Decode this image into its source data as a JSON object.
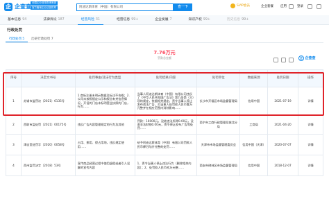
{
  "header": {
    "logo_text": "企查查",
    "logo_badges": [
      "全国企业信用查询系统",
      "官方备案企业征信机构"
    ],
    "search_value": "阿迪达斯体育（中国）有限公司",
    "search_button": "查一下",
    "svip_label": "SVIP会员",
    "nav": [
      "企业套餐",
      "应用",
      "登录"
    ]
  },
  "dim_tabs": [
    {
      "label": "基本信息",
      "count": "94",
      "state": "normal"
    },
    {
      "label": "法律诉讼",
      "count": "187",
      "state": "normal"
    },
    {
      "label": "经营风险",
      "count": "31",
      "state": "active"
    },
    {
      "label": "经营信息",
      "count": "99+",
      "state": "normal"
    },
    {
      "label": "企业发展",
      "count": "7",
      "state": "normal"
    },
    {
      "label": "知识产权",
      "count": "99+",
      "state": "normal"
    },
    {
      "label": "历史信息",
      "count": "99+",
      "state": "muted"
    }
  ],
  "section_title": "行政处罚",
  "sub_tabs": [
    {
      "label": "行政处罚 5",
      "active": true
    },
    {
      "label": "历史行政处罚 7",
      "active": false
    }
  ],
  "stats": {
    "value": "7.76万元",
    "label": "罚款总金额"
  },
  "qcc_stamp": "企查查",
  "table": {
    "headers": [
      "序号",
      "决定文书号",
      "处罚事由/违法行为类型",
      "处罚结果/内容",
      "处罚单位",
      "数据来源",
      "处罚日期",
      "操作"
    ],
    "rows": [
      {
        "index": "1",
        "doc": "苏锡市监罚决〔2021〕6135号",
        "reason": "1.商标注册未明示数据及标注不合格；2.公司未按照规定公示和报告有关信息情况，开设的门店未标明营业执照的门店，行为……",
        "result": "当事人阿迪达斯体育（中国）有限公司违反了《中华人民共和国广告法》第九条第（三）项的规定，依据相关规定，责令当事人停止发布违法广告，对当事人处罚款人民币壹万元整并在相应范围内消除影响……",
        "unit": "长沙市开福区市场监督管理局",
        "source": "信用中国",
        "date": "2021-07-19",
        "action": "详情"
      },
      {
        "index": "2",
        "doc": "西联市监处罚〔2021〕00175号",
        "reason": "违反广告内容管理规定的行为及其他",
        "result": "罚款：16000元，没收违法所得0.00元，没收非法财物0.00元，责令停止发布广告等处罚……",
        "unit": "西宁市工商行政管理局城北分局",
        "source": "工商局",
        "date": "2021-04-20",
        "action": "详情"
      },
      {
        "index": "3",
        "doc": "津自贸处罚字〔2020〕0058号",
        "reason": "占用、挪用、侵占用地，违反规定使用……",
        "result": "给予阿迪达斯体育（中国）有限公司罚款人民币肆万陆仟元整的处罚……",
        "unit": "天津市市场监督管理委员会",
        "source": "信用中国（天津）",
        "date": "2020-07-07",
        "action": "详情"
      },
      {
        "index": "4",
        "doc": "西市监罚决字〔2018〕53号",
        "reason": "宣传商品经营过程中使用虚假或者引人误解的宣传内容",
        "result": "1、责令当事人停止违法行为（删除相关内容）；2、处罚款人民币贰万元整……",
        "unit": "西安市碑林区市场监督管理局",
        "source": "信用中国",
        "date": "2018-12-07",
        "action": "详情"
      }
    ]
  }
}
